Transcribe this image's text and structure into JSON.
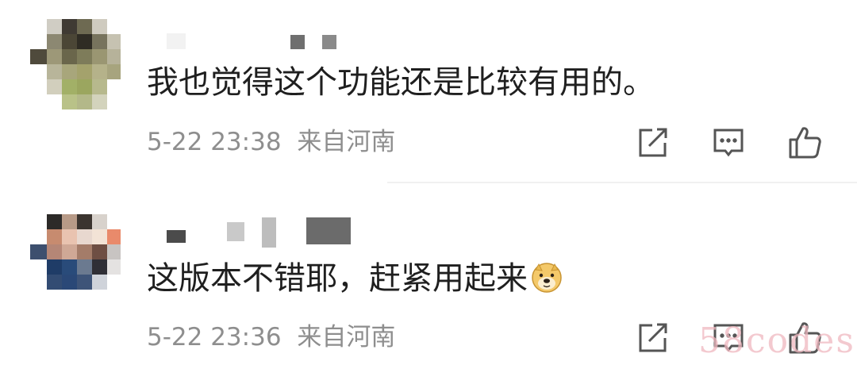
{
  "comments": [
    {
      "text": "我也觉得这个功能还是比较有用的。",
      "time": "5-22 23:38",
      "location": "来自河南",
      "emoji": "",
      "avatar_icon": "pixelated-avatar"
    },
    {
      "text": "这版本不错耶，赶紧用起来",
      "time": "5-22 23:36",
      "location": "来自河南",
      "emoji": "doge-emoji",
      "avatar_icon": "pixelated-avatar"
    }
  ],
  "actions": [
    "share-icon",
    "comment-icon",
    "like-icon"
  ],
  "watermark": "58codes"
}
